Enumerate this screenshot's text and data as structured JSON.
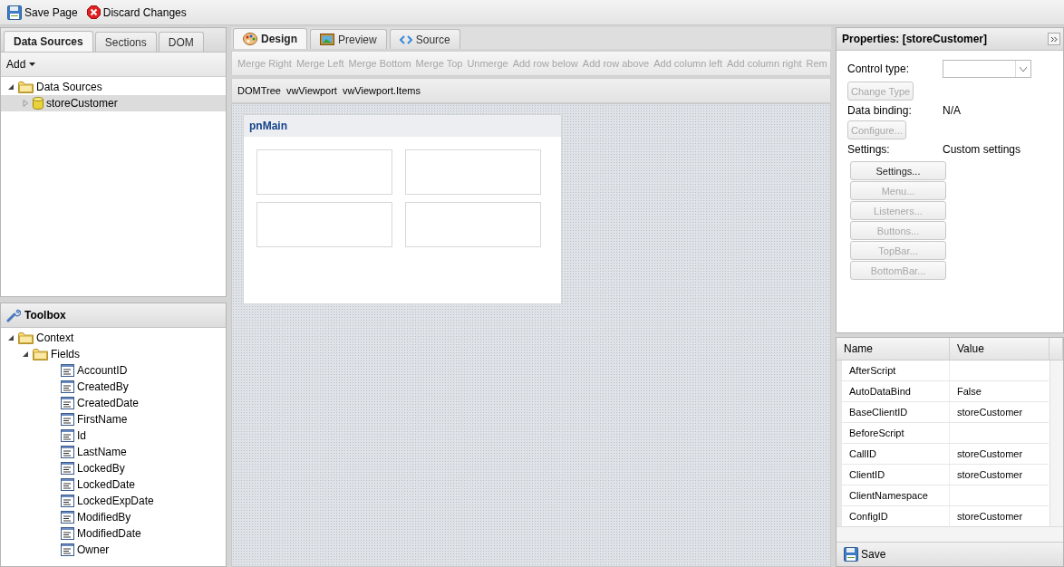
{
  "toolbar": [
    {
      "kind": "save",
      "label": "Save Page"
    },
    {
      "kind": "discard",
      "label": "Discard Changes"
    }
  ],
  "left_tabs": [
    {
      "label": "Data Sources",
      "selected": true
    },
    {
      "label": "Sections",
      "selected": false
    },
    {
      "label": "DOM",
      "selected": false
    }
  ],
  "add_menu": {
    "label": "Add"
  },
  "data_tree": [
    {
      "kind": "folder",
      "label": "Data Sources",
      "expanded": true,
      "selected": false,
      "children": [
        {
          "kind": "store",
          "label": "storeCustomer",
          "expanded": false,
          "selected": true
        }
      ]
    }
  ],
  "toolbox": {
    "title": "Toolbox",
    "tree": [
      {
        "kind": "folder",
        "label": "Context",
        "expanded": true,
        "selected": false,
        "children": [
          {
            "kind": "folder",
            "label": "Fields",
            "expanded": true,
            "selected": false,
            "children": [
              {
                "kind": "field",
                "label": "AccountID",
                "selected": false
              },
              {
                "kind": "field",
                "label": "CreatedBy",
                "selected": false
              },
              {
                "kind": "field",
                "label": "CreatedDate",
                "selected": false
              },
              {
                "kind": "field",
                "label": "FirstName",
                "selected": false
              },
              {
                "kind": "field",
                "label": "Id",
                "selected": false
              },
              {
                "kind": "field",
                "label": "LastName",
                "selected": false
              },
              {
                "kind": "field",
                "label": "LockedBy",
                "selected": false
              },
              {
                "kind": "field",
                "label": "LockedDate",
                "selected": false
              },
              {
                "kind": "field",
                "label": "LockedExpDate",
                "selected": false
              },
              {
                "kind": "field",
                "label": "ModifiedBy",
                "selected": false
              },
              {
                "kind": "field",
                "label": "ModifiedDate",
                "selected": false
              },
              {
                "kind": "field",
                "label": "Owner",
                "selected": false
              }
            ]
          }
        ]
      }
    ]
  },
  "editor_tabs": [
    {
      "kind": "design",
      "label": "Design",
      "selected": true
    },
    {
      "kind": "preview",
      "label": "Preview",
      "selected": false
    },
    {
      "kind": "source",
      "label": "Source",
      "selected": false
    }
  ],
  "layout_actions": [
    {
      "label": "Merge Right",
      "disabled": true
    },
    {
      "label": "Merge Left",
      "disabled": true
    },
    {
      "label": "Merge Bottom",
      "disabled": true
    },
    {
      "label": "Merge Top",
      "disabled": true
    },
    {
      "label": "Unmerge",
      "disabled": true
    },
    {
      "label": "Add row below",
      "disabled": true
    },
    {
      "label": "Add row above",
      "disabled": true
    },
    {
      "label": "Add column left",
      "disabled": true
    },
    {
      "label": "Add column right",
      "disabled": true
    },
    {
      "label": "Rem",
      "disabled": true
    }
  ],
  "breadcrumb": [
    "DOMTree",
    "vwViewport",
    "vwViewport.Items"
  ],
  "canvas": {
    "panel_title": "pnMain"
  },
  "properties": {
    "title": "Properties: [storeCustomer]",
    "control_type_label": "Control type:",
    "change_type": {
      "label": "Change Type",
      "disabled": true
    },
    "data_binding_label": "Data binding:",
    "data_binding_value": "N/A",
    "configure": {
      "label": "Configure...",
      "disabled": true
    },
    "settings_label": "Settings:",
    "settings_value": "Custom settings",
    "buttons": [
      {
        "label": "Settings...",
        "disabled": false
      },
      {
        "label": "Menu...",
        "disabled": true
      },
      {
        "label": "Listeners...",
        "disabled": true
      },
      {
        "label": "Buttons...",
        "disabled": true
      },
      {
        "label": "TopBar...",
        "disabled": true
      },
      {
        "label": "BottomBar...",
        "disabled": true
      }
    ]
  },
  "grid": {
    "columns": [
      "Name",
      "Value"
    ],
    "rows": [
      {
        "name": "AfterScript",
        "value": ""
      },
      {
        "name": "AutoDataBind",
        "value": "False"
      },
      {
        "name": "BaseClientID",
        "value": "storeCustomer"
      },
      {
        "name": "BeforeScript",
        "value": ""
      },
      {
        "name": "CallID",
        "value": "storeCustomer"
      },
      {
        "name": "ClientID",
        "value": "storeCustomer"
      },
      {
        "name": "ClientNamespace",
        "value": ""
      },
      {
        "name": "ConfigID",
        "value": "storeCustomer"
      }
    ]
  },
  "save_bar": {
    "label": "Save"
  }
}
